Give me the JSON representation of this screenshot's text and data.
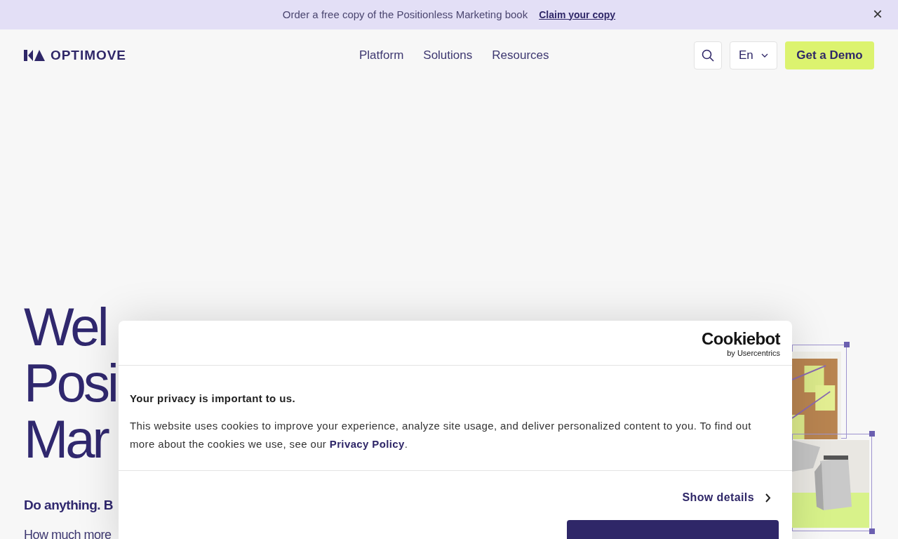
{
  "banner": {
    "text": "Order a free copy of the Positionless Marketing book",
    "link": "Claim your copy",
    "close": "×"
  },
  "header": {
    "logo": "OPTIMOVE",
    "nav": [
      {
        "label": "Platform"
      },
      {
        "label": "Solutions"
      },
      {
        "label": "Resources"
      }
    ],
    "language": "En",
    "cta": "Get a Demo"
  },
  "hero": {
    "heading_lines": [
      "Wel",
      "Posi",
      "Mar"
    ],
    "tagline": "Do anything. B",
    "text": "How much more"
  },
  "cookie_dialog": {
    "brand": "Cookiebot",
    "brand_sub": "by Usercentrics",
    "title": "Your privacy is important to us.",
    "body": "This website uses cookies to improve your experience, analyze site usage, and deliver personalized content to you. To find out more about the cookies we use, see our ",
    "link": "Privacy Policy",
    "body_end": ".",
    "show_details": "Show details"
  }
}
